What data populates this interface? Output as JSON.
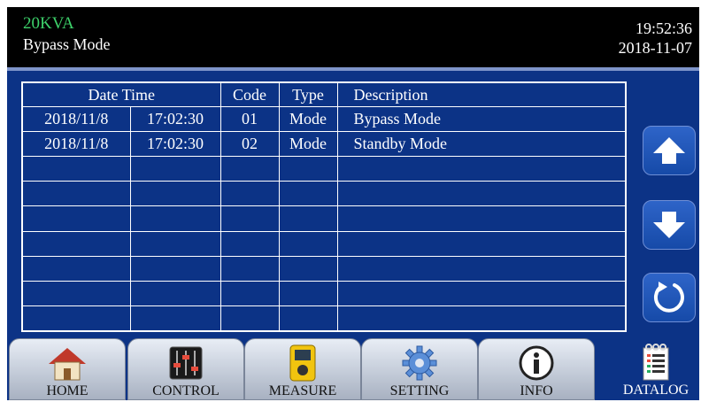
{
  "header": {
    "model": "20KVA",
    "mode": "Bypass Mode",
    "time": "19:52:36",
    "date": "2018-11-07"
  },
  "table": {
    "columns": [
      "Date Time",
      "Code",
      "Type",
      "Description"
    ],
    "rows": [
      {
        "date": "2018/11/8",
        "time": "17:02:30",
        "code": "01",
        "type": "Mode",
        "description": "Bypass Mode"
      },
      {
        "date": "2018/11/8",
        "time": "17:02:30",
        "code": "02",
        "type": "Mode",
        "description": "Standby Mode"
      },
      {
        "date": "",
        "time": "",
        "code": "",
        "type": "",
        "description": ""
      },
      {
        "date": "",
        "time": "",
        "code": "",
        "type": "",
        "description": ""
      },
      {
        "date": "",
        "time": "",
        "code": "",
        "type": "",
        "description": ""
      },
      {
        "date": "",
        "time": "",
        "code": "",
        "type": "",
        "description": ""
      },
      {
        "date": "",
        "time": "",
        "code": "",
        "type": "",
        "description": ""
      },
      {
        "date": "",
        "time": "",
        "code": "",
        "type": "",
        "description": ""
      },
      {
        "date": "",
        "time": "",
        "code": "",
        "type": "",
        "description": ""
      }
    ]
  },
  "side_buttons": {
    "up_icon": "arrow-up-icon",
    "down_icon": "arrow-down-icon",
    "refresh_icon": "refresh-icon"
  },
  "nav": {
    "home": "HOME",
    "control": "CONTROL",
    "measure": "MEASURE",
    "setting": "SETTING",
    "info": "INFO",
    "datalog": "DATALOG"
  },
  "colors": {
    "screen_bg": "#0c3386",
    "header_bg": "#000000",
    "model_text": "#3dd16a",
    "nav_button": "#c4ccd9"
  }
}
